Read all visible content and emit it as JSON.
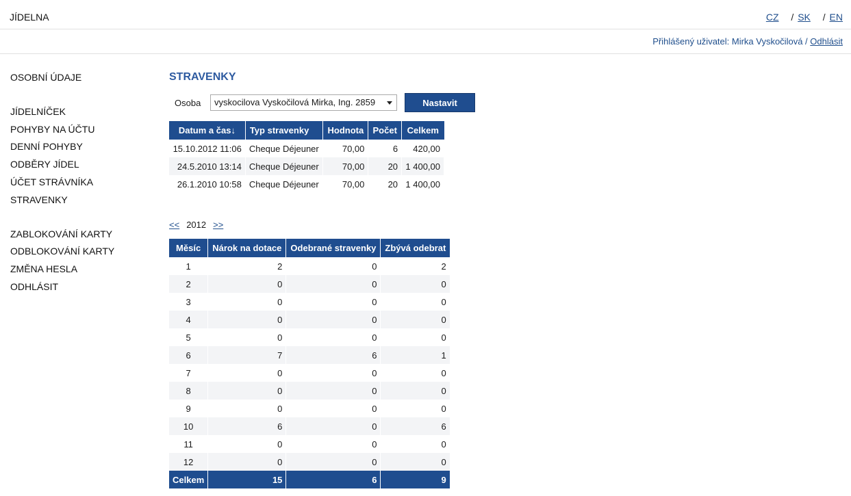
{
  "header": {
    "brand": "JÍDELNA",
    "languages": [
      {
        "label": "CZ"
      },
      {
        "label": "SK"
      },
      {
        "label": "EN"
      }
    ],
    "separator": "/"
  },
  "userbar": {
    "logged_in_prefix": "Přihlášený uživatel: Mirka Vyskočilová",
    "separator": "/",
    "logout_link": "Odhlásit"
  },
  "sidebar": {
    "group1": [
      "OSOBNÍ ÚDAJE"
    ],
    "group2": [
      "JÍDELNÍČEK",
      "POHYBY NA ÚČTU",
      "DENNÍ POHYBY",
      "ODBĚRY JÍDEL",
      "ÚČET STRÁVNÍKA",
      "STRAVENKY"
    ],
    "group3": [
      "ZABLOKOVÁNÍ KARTY",
      "ODBLOKOVÁNÍ KARTY",
      "ZMĚNA HESLA",
      "ODHLÁSIT"
    ]
  },
  "main": {
    "title": "STRAVENKY",
    "person_label": "Osoba",
    "person_selected": "vyskocilova Vyskočilová Mirka, Ing. 2859",
    "set_button": "Nastavit",
    "vouchers": {
      "columns": [
        "Datum a čas↓",
        "Typ stravenky",
        "Hodnota",
        "Počet",
        "Celkem"
      ],
      "rows": [
        [
          "15.10.2012 11:06",
          "Cheque Déjeuner",
          "70,00",
          "6",
          "420,00"
        ],
        [
          "24.5.2010 13:14",
          "Cheque Déjeuner",
          "70,00",
          "20",
          "1 400,00"
        ],
        [
          "26.1.2010 10:58",
          "Cheque Déjeuner",
          "70,00",
          "20",
          "1 400,00"
        ]
      ]
    },
    "year_nav": {
      "prev": "<<",
      "year": "2012",
      "next": ">>"
    },
    "months": {
      "columns": [
        "Měsíc",
        "Nárok na dotace",
        "Odebrané stravenky",
        "Zbývá odebrat"
      ],
      "rows": [
        [
          "1",
          "2",
          "0",
          "2"
        ],
        [
          "2",
          "0",
          "0",
          "0"
        ],
        [
          "3",
          "0",
          "0",
          "0"
        ],
        [
          "4",
          "0",
          "0",
          "0"
        ],
        [
          "5",
          "0",
          "0",
          "0"
        ],
        [
          "6",
          "7",
          "6",
          "1"
        ],
        [
          "7",
          "0",
          "0",
          "0"
        ],
        [
          "8",
          "0",
          "0",
          "0"
        ],
        [
          "9",
          "0",
          "0",
          "0"
        ],
        [
          "10",
          "6",
          "0",
          "6"
        ],
        [
          "11",
          "0",
          "0",
          "0"
        ],
        [
          "12",
          "0",
          "0",
          "0"
        ]
      ],
      "total": [
        "Celkem",
        "15",
        "6",
        "9"
      ]
    }
  }
}
